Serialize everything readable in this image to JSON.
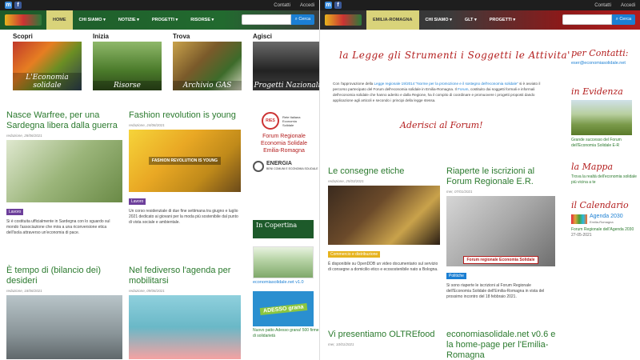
{
  "left": {
    "top_links": [
      "Contatti",
      "Accedi"
    ],
    "nav": [
      "HOME",
      "CHI SIAMO",
      "NOTIZIE",
      "PROGETTI",
      "RISORSE"
    ],
    "nav_carets": [
      "",
      "▾",
      "▾",
      "▾",
      "▾"
    ],
    "search_placeholder": "",
    "search_button": "Cerca",
    "quick": [
      {
        "head": "Scopri",
        "caption": "L'Economia solidale"
      },
      {
        "head": "Inizia",
        "caption": "Risorse"
      },
      {
        "head": "Trova",
        "caption": "Archivio GAS"
      },
      {
        "head": "Agisci",
        "caption": "Progetti Nazionali"
      }
    ],
    "articles": [
      {
        "title": "Nasce Warfree, per una Sardegna libera dalla guerra",
        "meta": "redazione, 28/06/2021",
        "tag": "Lavoro",
        "text": "Si è costituita ufficialmente in Sardegna con lo sguardo sul mondo l'associazione che mira a una riconversione etica dell'isola attraverso un'economia di pace."
      },
      {
        "title": "Fashion revolution is young",
        "meta": "redazione, 24/06/2021",
        "img_title": "FASHION REVOLUTION IS YOUNG",
        "tag": "Lavoro",
        "text": "Un corso residenziale di due fine settimana tra giugno e luglio 2021 dedicato ai giovani per la moda più sostenibile dal punto di vista sociale e ambientale."
      },
      {
        "title": "È tempo di (bilancio dei) desideri",
        "meta": "redazione, 18/06/2021"
      },
      {
        "title": "Nel fediverso l'agenda per mobilitarsi",
        "meta": "redazione, 09/06/2021"
      }
    ],
    "sidebar": {
      "ries_badge": "RIES",
      "ries_sub": "Rete Italiana Economia Solidale",
      "forum_title": "Forum Regionale Economia Solidale Emilia-Romagna",
      "energia": "ENERGIA",
      "energia_sub": "BENI COMUNI E ECONOMIA SOLIDALE",
      "incopertina": "In Copertina",
      "cap1": "economiasolidale.net v1.0",
      "adesso": "ADESSO grana",
      "adesso_text": "Nuovo patto Adesso grana! 500 firme di solidarietà"
    }
  },
  "right": {
    "top_links": [
      "Contatti",
      "Accedi"
    ],
    "nav": [
      "EMILIA-ROMAGNA",
      "CHI SIAMO",
      "GLT",
      "PROGETTI"
    ],
    "nav_carets": [
      "",
      "▾",
      "▾",
      "▾"
    ],
    "search_placeholder": "",
    "search_button": "Cerca",
    "heading": "la Legge   gli Strumenti   i Soggetti   le Attivita'",
    "para_a": "Con l'approvazione della ",
    "para_link": "Legge regionale 19/2014 \"Norme per la promozione e il sostegno dell'economia solidale\"",
    "para_b": " si è avviato il percorso partecipato del Forum dell'economia solidale in Emilia-Romagna. Il ",
    "para_link2": "Forum",
    "para_c": ", costituito dai soggetti formali e informali dell'economia solidale che hanno aderito e dalla Regione, ha il compito di coordinare e promuovere i progetti proposti dando applicazione agli articoli e secondo i principi della legge stessa.",
    "forum_call": "Aderisci al Forum!",
    "articles": [
      {
        "title": "Le consegne etiche",
        "meta": "redazione, 25/03/2021",
        "tag": "Commercio e distribuzione",
        "text": "È disponibile su OpenDDB un video documentario sul servizio di consegne a domicilio etico e ecosostenibile nato a Bologna."
      },
      {
        "title": "Riaperte le iscrizioni al Forum Regionale E.R.",
        "meta": "mer, 07/01/2021",
        "img_banner": "Forum regionale Economia Solidale",
        "tag": "Politiche",
        "text": "Si sono riaperte le iscrizioni al Forum Regionale dell'Economia Solidale dell'Emilia-Romagna in vista del prossimo incontro del 18 febbraio 2021."
      },
      {
        "title": "Vi presentiamo OLTREfood",
        "meta": "mer, 10/01/2021"
      },
      {
        "title": "economiasolidale.net v0.6 e la home-page per l'Emilia-Romagna",
        "meta": ""
      }
    ],
    "sidebar": {
      "contacts_head": "per Contatti:",
      "email": "eser@economiasolidale.net",
      "evidence_head": "in Evidenza",
      "evidence_text": "Grande successo del Forum dell'Economia Solidale E-R",
      "map_head": "la Mappa",
      "map_text": "Trova la realtà dell'economia solidale più vicina a te",
      "cal_head": "il Calendario",
      "agenda_title": "Agenda 2030",
      "agenda_sub": "Emilia-Romagna",
      "agenda_text": "Forum Regionale dell'Agenda 2030",
      "agenda_date": "27-05-2021"
    }
  }
}
